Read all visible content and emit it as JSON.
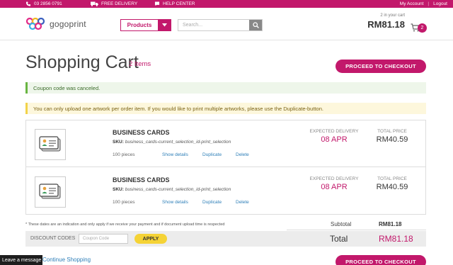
{
  "topbar": {
    "phone": "03 2856 0791",
    "delivery": "FREE DELIVERY",
    "help": "HELP CENTER",
    "my_account": "My Account",
    "separator": "|",
    "logout": "Logout"
  },
  "header": {
    "logo_text": "gogoprint",
    "products_label": "Products",
    "search_placeholder": "Search...",
    "cart_caption": "2 in your cart",
    "cart_amount": "RM81.18",
    "cart_count": "2"
  },
  "page": {
    "title": "Shopping Cart",
    "items_count": "2 Items",
    "checkout_label": "PROCEED TO CHECKOUT"
  },
  "alerts": {
    "success": "Coupon code was canceled.",
    "warning": "You can only upload one artwork per order item. If you would like to print multiple artworks, please use the Duplicate-button."
  },
  "cart_items": [
    {
      "name": "BUSINESS CARDS",
      "sku_label": "SKU:",
      "sku": "business_cards-current_selection_id-print_selection",
      "quantity": "100 pieces",
      "show_details": "Show details",
      "duplicate": "Duplicate",
      "delete": "Delete",
      "expected_label": "EXPECTED DELIVERY",
      "expected_date": "08 APR",
      "total_label": "TOTAL PRICE",
      "total_price": "RM40.59"
    },
    {
      "name": "BUSINESS CARDS",
      "sku_label": "SKU:",
      "sku": "business_cards-current_selection_id-print_selection",
      "quantity": "100 pieces",
      "show_details": "Show details",
      "duplicate": "Duplicate",
      "delete": "Delete",
      "expected_label": "EXPECTED DELIVERY",
      "expected_date": "08 APR",
      "total_label": "TOTAL PRICE",
      "total_price": "RM40.59"
    }
  ],
  "summary": {
    "note": "* These dates are an indication and only apply if we receive your payment and if document upload time is respected",
    "subtotal_label": "Subtotal",
    "subtotal_value": "RM81.18",
    "discount_label": "DISCOUNT CODES",
    "coupon_placeholder": "Coupon Code",
    "apply_label": "APPLY",
    "total_label": "Total",
    "total_value": "RM81.18"
  },
  "footer": {
    "leave_message": "Leave a message",
    "continue_shopping": "Continue Shopping"
  },
  "colors": {
    "brand": "#c2186b",
    "success": "#69b542",
    "warning": "#f2d34a",
    "apply": "#f5d336",
    "link": "#2e7fb8"
  }
}
